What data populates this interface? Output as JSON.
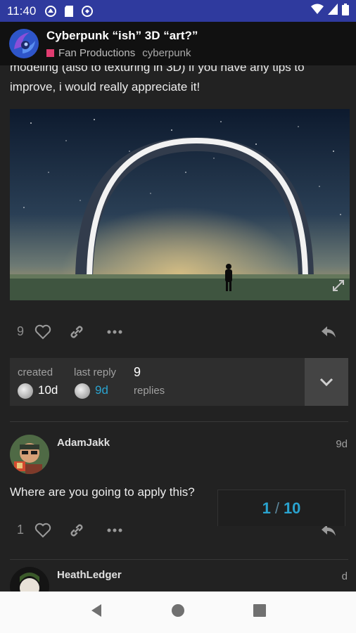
{
  "status_bar": {
    "time": "11:40"
  },
  "header": {
    "title": "Cyberpunk “ish” 3D “art?”",
    "category": "Fan Productions",
    "tag": "cyberpunk",
    "category_color": "#e03c70"
  },
  "post": {
    "text_line1": "modeling (also to texturing in 3D) if you have any tips to",
    "text_line2": "improve, i would really appreciate it!",
    "like_count": "9"
  },
  "topic_meta": {
    "created_label": "created",
    "created_value": "10d",
    "last_reply_label": "last reply",
    "last_reply_value": "9d",
    "replies_count": "9",
    "replies_label": "replies"
  },
  "reply1": {
    "username": "AdamJakk",
    "date": "9d",
    "text": "Where are you going to apply this?",
    "like_count": "1"
  },
  "reply2": {
    "username": "HeathLedger",
    "date": "d"
  },
  "progress": {
    "current": "1",
    "separator": "/",
    "total": "10"
  },
  "colors": {
    "accent": "#2aa3cf",
    "status_bar": "#2f3a9e",
    "header_bg": "#111111"
  }
}
